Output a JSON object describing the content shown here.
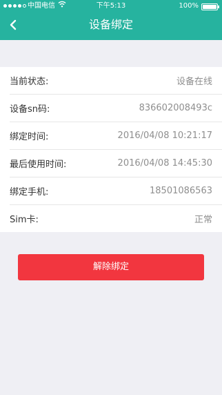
{
  "statusbar": {
    "carrier": "中国电信",
    "time": "下午5:13",
    "battery_pct": "100%",
    "battery_level": 1.0,
    "signal_bars": 4
  },
  "navbar": {
    "title": "设备绑定",
    "back_icon": "chevron-left-icon"
  },
  "info": {
    "rows": [
      {
        "label": "当前状态:",
        "value": "设备在线"
      },
      {
        "label": "设备sn码:",
        "value": "836602008493c"
      },
      {
        "label": "绑定时间:",
        "value": "2016/04/08 10:21:17"
      },
      {
        "label": "最后使用时间:",
        "value": "2016/04/08 14:45:30"
      },
      {
        "label": "绑定手机:",
        "value": "18501086563"
      },
      {
        "label": "Sim卡:",
        "value": "正常"
      }
    ]
  },
  "actions": {
    "unbind_label": "解除绑定"
  },
  "colors": {
    "header": "#26b39f",
    "button": "#f2363f",
    "background": "#efeff4"
  }
}
